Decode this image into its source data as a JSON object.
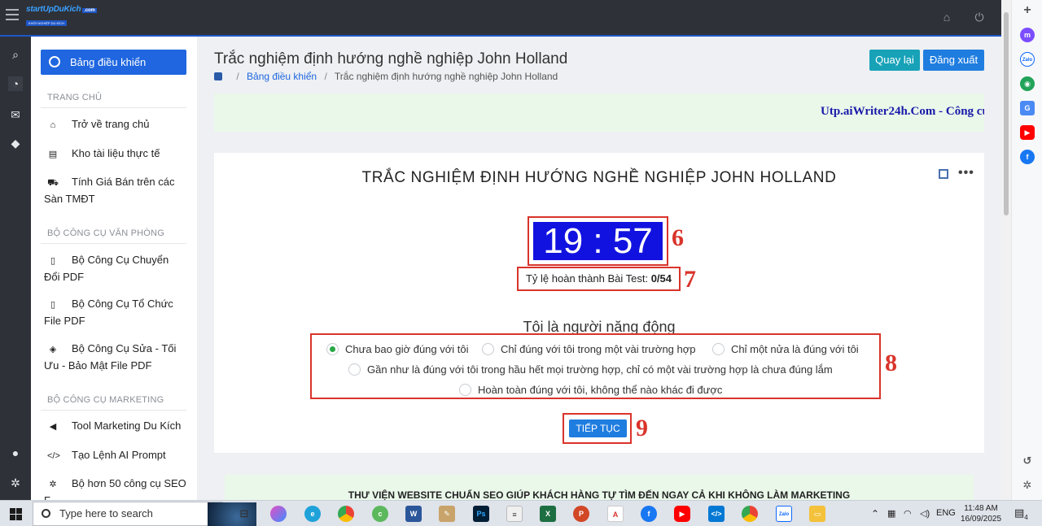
{
  "app": {
    "logo_title": "startUpDuKich",
    "logo_domain": ".com",
    "logo_tagline": "KHỞI NGHIỆP DU KÍCH"
  },
  "sidebar": {
    "dashboard_label": "Bảng điều khiển",
    "sections": [
      {
        "title": "TRANG CHỦ"
      },
      {
        "title": "BỘ CÔNG CỤ VĂN PHÒNG"
      },
      {
        "title": "BỘ CÔNG CỤ MARKETING"
      }
    ],
    "items": [
      {
        "label": "Trở về trang chủ",
        "icon": "home-icon"
      },
      {
        "label": "Kho tài liệu thực tế",
        "icon": "file-icon"
      },
      {
        "label": "Tính Giá Bán trên các Sàn TMĐT",
        "icon": "cart-icon"
      },
      {
        "label": "Bộ Công Cụ Chuyển Đổi PDF",
        "icon": "pdf-icon"
      },
      {
        "label": "Bộ Công Cụ Tổ Chức File PDF",
        "icon": "pdf-icon"
      },
      {
        "label": "Bộ Công Cụ Sửa - Tối Ưu - Bảo Mật File PDF",
        "icon": "shield-icon"
      },
      {
        "label": "Tool Marketing Du Kích",
        "icon": "megaphone-icon"
      },
      {
        "label": "Tạo Lệnh AI Prompt",
        "icon": "code-icon"
      },
      {
        "label": "Bộ hơn 50 công cụ SEO F...",
        "icon": "gear-icon"
      }
    ]
  },
  "header": {
    "title": "Trắc nghiệm định hướng nghề nghiệp John Holland",
    "breadcrumb": [
      "Bảng điều khiển",
      "Trắc nghiệm định hướng nghề nghiệp John Holland"
    ],
    "back_label": "Quay lại",
    "logout_label": "Đăng xuất"
  },
  "banner": {
    "text": "Utp.aiWriter24h.Com - Công cụ viết bài chuẩn SEO"
  },
  "quiz": {
    "title": "TRẮC NGHIỆM ĐỊNH HƯỚNG NGHỀ NGHIỆP JOHN HOLLAND",
    "timer": "19 : 57",
    "progress_label": "Tỷ lệ hoàn thành Bài Test:",
    "progress_value": "0/54",
    "progress_fraction": 0,
    "question": "Tôi là người năng động",
    "options": [
      {
        "label": "Chưa bao giờ đúng với tôi",
        "selected": true
      },
      {
        "label": "Chỉ đúng với tôi trong một vài trường hợp",
        "selected": false
      },
      {
        "label": "Chỉ một nửa là đúng với tôi",
        "selected": false
      },
      {
        "label": "Gần như là đúng với tôi trong hầu hết mọi trường hợp, chỉ có một vài trường hợp là chưa đúng lắm",
        "selected": false
      },
      {
        "label": "Hoàn toàn đúng với tôi, không thể nào khác đi được",
        "selected": false
      }
    ],
    "next_label": "TIẾP TỤC",
    "annotations": [
      "6",
      "7",
      "8",
      "9"
    ],
    "accent_color": "#1f7de0",
    "timer_color": "#1212e0",
    "annotation_color": "#d9342b"
  },
  "footer_banner": {
    "text": "THƯ VIỆN WEBSITE CHUẨN SEO GIÚP KHÁCH HÀNG TỰ TÌM ĐẾN NGAY CẢ KHI KHÔNG LÀM MARKETING"
  },
  "taskbar": {
    "search_placeholder": "Type here to search",
    "language": "ENG",
    "time": "11:48 AM",
    "date": "16/09/2025",
    "notification_count": "4",
    "apps": [
      "task-view",
      "copilot",
      "edge",
      "chrome",
      "coccoc",
      "word",
      "paint",
      "photoshop",
      "notepad",
      "excel",
      "powerpoint",
      "pdf",
      "facebook",
      "youtube",
      "vscode",
      "chrome-profile",
      "zalo",
      "file-explorer"
    ]
  },
  "edge_sidebar": {
    "icons": [
      "messenger-icon",
      "zalo-icon",
      "games-icon",
      "translate-icon",
      "youtube-icon",
      "facebook-icon",
      "history-icon",
      "settings-icon"
    ],
    "zalo_text": "Zalo"
  }
}
